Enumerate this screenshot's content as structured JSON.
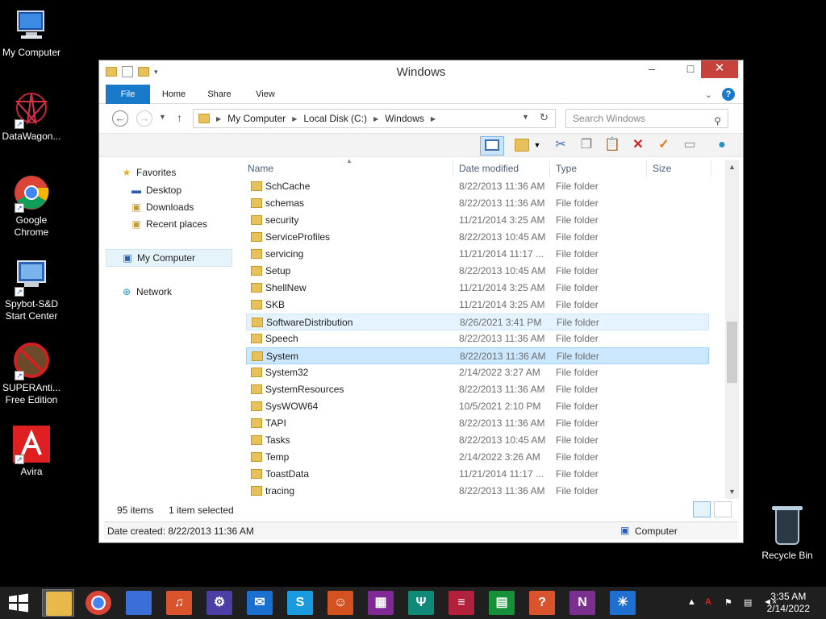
{
  "desktop": {
    "icons": [
      {
        "label": "My Computer"
      },
      {
        "label": "DataWagon..."
      },
      {
        "label": "Google Chrome"
      },
      {
        "label": "Spybot-S&D Start Center"
      },
      {
        "label": "SUPERAnti... Free Edition"
      },
      {
        "label": "Avira"
      }
    ],
    "recycle_bin": "Recycle Bin"
  },
  "window": {
    "title": "Windows",
    "controls": {
      "minimize": "–",
      "maximize": "□",
      "close": "✕"
    },
    "ribbon_tabs": [
      "File",
      "Home",
      "Share",
      "View"
    ],
    "address": {
      "crumbs": [
        "My Computer",
        "Local Disk (C:)",
        "Windows"
      ]
    },
    "search": {
      "placeholder": "Search Windows"
    },
    "nav_pane": {
      "favorites": "Favorites",
      "desktop": "Desktop",
      "downloads": "Downloads",
      "recent": "Recent places",
      "my_computer": "My Computer",
      "network": "Network"
    },
    "columns": [
      "Name",
      "Date modified",
      "Type",
      "Size"
    ],
    "files": [
      {
        "name": "SchCache",
        "date": "8/22/2013 11:36 AM",
        "type": "File folder"
      },
      {
        "name": "schemas",
        "date": "8/22/2013 11:36 AM",
        "type": "File folder"
      },
      {
        "name": "security",
        "date": "11/21/2014 3:25 AM",
        "type": "File folder"
      },
      {
        "name": "ServiceProfiles",
        "date": "8/22/2013 10:45 AM",
        "type": "File folder"
      },
      {
        "name": "servicing",
        "date": "11/21/2014 11:17 ...",
        "type": "File folder"
      },
      {
        "name": "Setup",
        "date": "8/22/2013 10:45 AM",
        "type": "File folder"
      },
      {
        "name": "ShellNew",
        "date": "11/21/2014 3:25 AM",
        "type": "File folder"
      },
      {
        "name": "SKB",
        "date": "11/21/2014 3:25 AM",
        "type": "File folder"
      },
      {
        "name": "SoftwareDistribution",
        "date": "8/26/2021 3:41 PM",
        "type": "File folder",
        "state": "hover"
      },
      {
        "name": "Speech",
        "date": "8/22/2013 11:36 AM",
        "type": "File folder"
      },
      {
        "name": "System",
        "date": "8/22/2013 11:36 AM",
        "type": "File folder",
        "state": "selected"
      },
      {
        "name": "System32",
        "date": "2/14/2022 3:27 AM",
        "type": "File folder"
      },
      {
        "name": "SystemResources",
        "date": "8/22/2013 11:36 AM",
        "type": "File folder"
      },
      {
        "name": "SysWOW64",
        "date": "10/5/2021 2:10 PM",
        "type": "File folder"
      },
      {
        "name": "TAPI",
        "date": "8/22/2013 11:36 AM",
        "type": "File folder"
      },
      {
        "name": "Tasks",
        "date": "8/22/2013 10:45 AM",
        "type": "File folder"
      },
      {
        "name": "Temp",
        "date": "2/14/2022 3:26 AM",
        "type": "File folder"
      },
      {
        "name": "ToastData",
        "date": "11/21/2014 11:17 ...",
        "type": "File folder"
      },
      {
        "name": "tracing",
        "date": "8/22/2013 11:36 AM",
        "type": "File folder"
      }
    ],
    "status": {
      "count": "95 items",
      "selected": "1 item selected"
    },
    "details": {
      "created": "Date created: 8/22/2013 11:36 AM",
      "location": "Computer"
    }
  },
  "taskbar": {
    "apps": [
      {
        "name": "file-explorer",
        "color": "#e8b84a"
      },
      {
        "name": "chrome",
        "color": "#3b78e7"
      },
      {
        "name": "app-blue-flame",
        "color": "#3b6fd8"
      },
      {
        "name": "music",
        "color": "#d9532c",
        "glyph": "♫"
      },
      {
        "name": "settings",
        "color": "#4b3fa6",
        "glyph": "⚙"
      },
      {
        "name": "mail",
        "color": "#1b6fd0",
        "glyph": "✉"
      },
      {
        "name": "skype",
        "color": "#1a9be0",
        "glyph": "S"
      },
      {
        "name": "people",
        "color": "#d45220",
        "glyph": "☺"
      },
      {
        "name": "maps",
        "color": "#7f2896",
        "glyph": "▦"
      },
      {
        "name": "food-drink",
        "color": "#0f8a78",
        "glyph": "Ψ"
      },
      {
        "name": "news",
        "color": "#b3203a",
        "glyph": "≡"
      },
      {
        "name": "store",
        "color": "#16913a",
        "glyph": "▤"
      },
      {
        "name": "help",
        "color": "#d9532c",
        "glyph": "?"
      },
      {
        "name": "onenote",
        "color": "#7b2f8f",
        "glyph": "N"
      },
      {
        "name": "weather",
        "color": "#1f6fd0",
        "glyph": "☀"
      }
    ],
    "clock": {
      "time": "3:35 AM",
      "date": "2/14/2022"
    }
  }
}
